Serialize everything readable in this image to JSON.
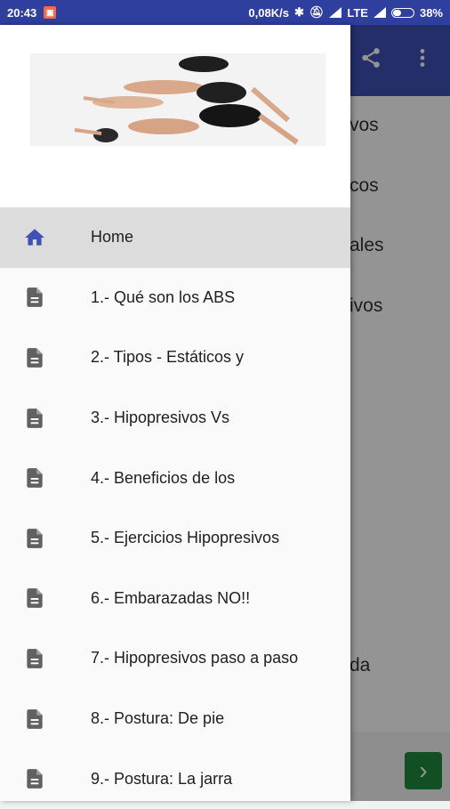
{
  "status_bar": {
    "time": "20:43",
    "network_speed": "0,08K/s",
    "network_type": "LTE",
    "battery": "38%",
    "battery_level": 0.38
  },
  "background_app": {
    "list_fragments": [
      "vos",
      "cos",
      "ales",
      "ivos",
      "da"
    ]
  },
  "drawer": {
    "items": [
      {
        "label": "Home",
        "icon": "home-icon",
        "active": true
      },
      {
        "label": "1.- Qué son los ABS",
        "icon": "document-icon"
      },
      {
        "label": "2.- Tipos - Estáticos y",
        "icon": "document-icon"
      },
      {
        "label": "3.- Hipopresivos Vs",
        "icon": "document-icon"
      },
      {
        "label": "4.- Beneficios de los",
        "icon": "document-icon"
      },
      {
        "label": "5.- Ejercicios Hipopresivos",
        "icon": "document-icon"
      },
      {
        "label": "6.- Embarazadas NO!!",
        "icon": "document-icon"
      },
      {
        "label": "7.- Hipopresivos paso a paso",
        "icon": "document-icon"
      },
      {
        "label": "8.- Postura: De pie",
        "icon": "document-icon"
      },
      {
        "label": "9.- Postura: La jarra",
        "icon": "document-icon"
      }
    ]
  },
  "colors": {
    "primary": "#3f51b5",
    "status_bar": "#2e3f9e",
    "active_icon": "#3f51b5",
    "inactive_icon": "#616161"
  }
}
